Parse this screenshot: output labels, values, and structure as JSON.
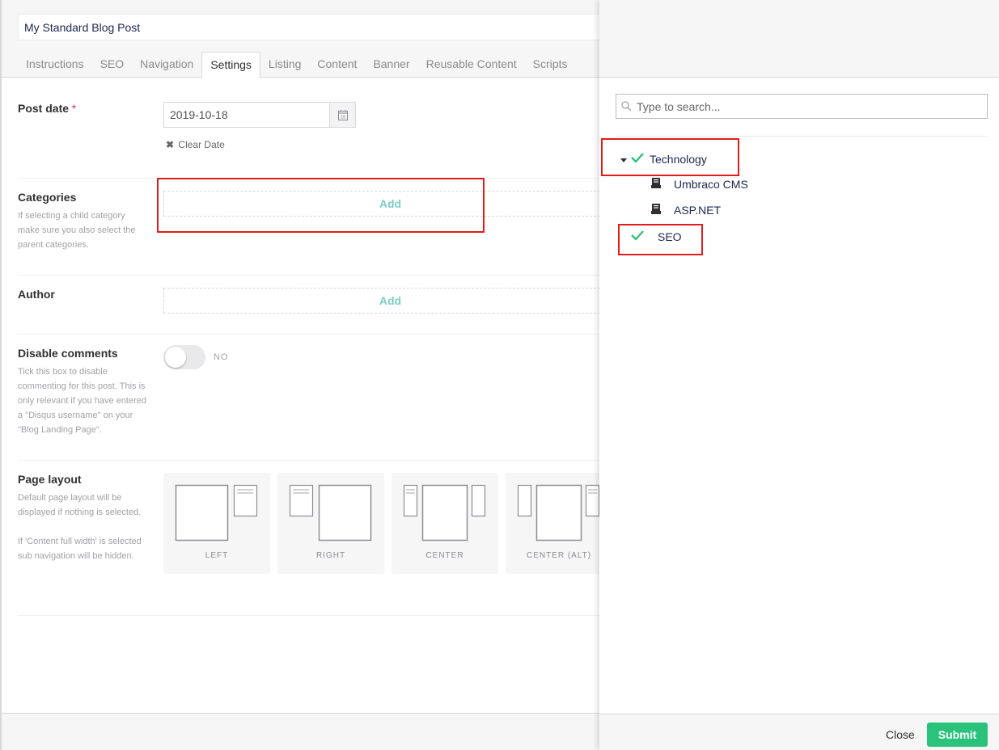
{
  "editor": {
    "title_value": "My Standard Blog Post",
    "tabs": [
      {
        "label": "Instructions"
      },
      {
        "label": "SEO"
      },
      {
        "label": "Navigation"
      },
      {
        "label": "Settings",
        "active": true
      },
      {
        "label": "Listing"
      },
      {
        "label": "Content"
      },
      {
        "label": "Banner"
      },
      {
        "label": "Reusable Content"
      },
      {
        "label": "Scripts"
      }
    ],
    "post_date": {
      "label": "Post date",
      "required_mark": "*",
      "value": "2019-10-18",
      "calendar_icon": "calendar-icon",
      "calendar_day": "18",
      "clear_icon": "✖",
      "clear_label": "Clear Date"
    },
    "categories": {
      "label": "Categories",
      "description": "If selecting a child category make sure you also select the parent categories.",
      "add_label": "Add"
    },
    "author": {
      "label": "Author",
      "add_label": "Add"
    },
    "disable_comments": {
      "label": "Disable comments",
      "description": "Tick this box to disable commenting for this post. This is only relevant if you have entered a \"Disqus username\" on your \"Blog Landing Page\".",
      "toggle_state": "NO"
    },
    "page_layout": {
      "label": "Page layout",
      "description_1": "Default page layout will be displayed if nothing is selected.",
      "description_2": "If 'Content full width' is selected sub navigation will be hidden.",
      "options": [
        {
          "label": "LEFT"
        },
        {
          "label": "RIGHT"
        },
        {
          "label": "CENTER"
        },
        {
          "label": "CENTER (ALT)"
        }
      ]
    }
  },
  "picker": {
    "search_placeholder": "Type to search...",
    "search_icon": "search-icon",
    "tree": [
      {
        "label": "Technology",
        "selected": true,
        "expanded": true,
        "icon": "check-icon"
      },
      {
        "label": "Umbraco CMS",
        "icon": "document-icon",
        "child": true
      },
      {
        "label": "ASP.NET",
        "icon": "document-icon",
        "child": true
      },
      {
        "label": "SEO",
        "selected": true,
        "icon": "check-icon"
      }
    ],
    "close_label": "Close",
    "submit_label": "Submit"
  },
  "colors": {
    "accent_add": "#7bcdc4",
    "check_green": "#2bc37c",
    "submit_green": "#2bc37c",
    "annotation_red": "#e31b1b",
    "required_red": "#e22c60"
  }
}
